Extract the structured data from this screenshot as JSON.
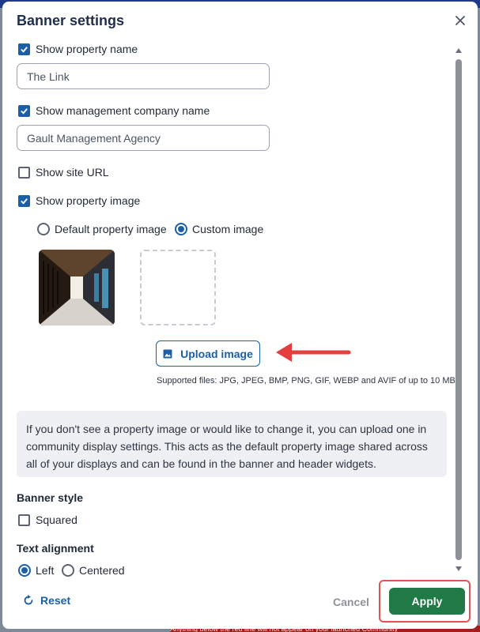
{
  "dialog": {
    "title": "Banner settings"
  },
  "property_name": {
    "checkbox_label": "Show property name",
    "checked": true,
    "value": "The Link"
  },
  "management_company": {
    "checkbox_label": "Show management company name",
    "checked": true,
    "value": "Gault Management Agency"
  },
  "site_url": {
    "checkbox_label": "Show site URL",
    "checked": false
  },
  "property_image": {
    "checkbox_label": "Show property image",
    "checked": true,
    "radio_default_label": "Default property image",
    "radio_custom_label": "Custom image",
    "selected": "Custom image",
    "upload_label": "Upload image",
    "supported_text": "Supported files: JPG, JPEG, BMP, PNG, GIF, WEBP and AVIF of up to 10 MB"
  },
  "info_text": "If you don't see a property image or would like to change it, you can upload one in community display settings. This acts as the default property image shared across all of your displays and can be found in the banner and header widgets.",
  "banner_style": {
    "label": "Banner style",
    "squared_label": "Squared",
    "squared_checked": false
  },
  "text_alignment": {
    "label": "Text alignment",
    "left_label": "Left",
    "centered_label": "Centered",
    "selected": "Left"
  },
  "footer": {
    "reset_label": "Reset",
    "cancel_label": "Cancel",
    "apply_label": "Apply"
  },
  "background_banner_text": "Anything below the red line will not appear on your launched Community",
  "colors": {
    "primary": "#1c5fa8",
    "apply": "#1f7a45",
    "highlight": "#e05555",
    "arrow": "#e53e3e"
  }
}
